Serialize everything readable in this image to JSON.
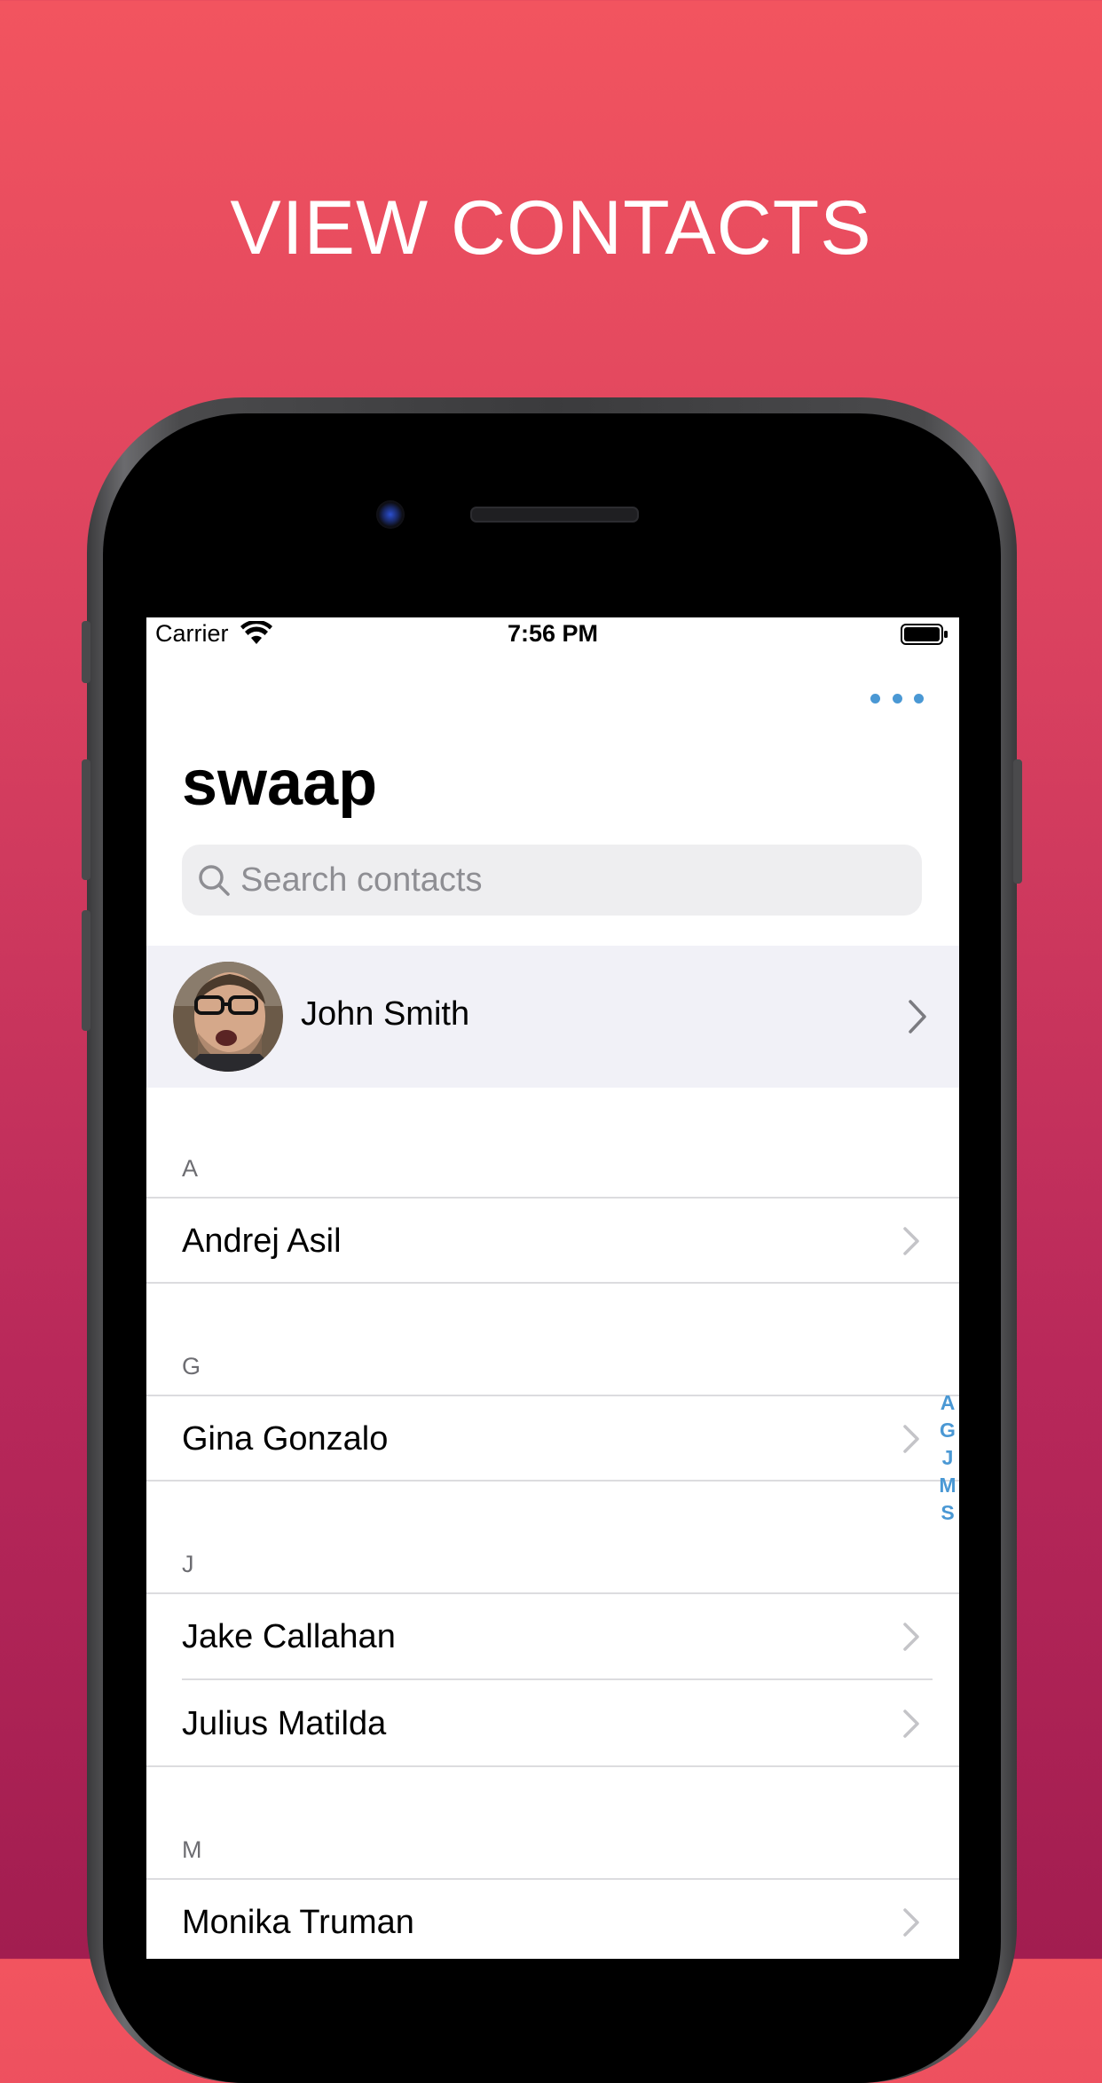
{
  "headline": "VIEW CONTACTS",
  "status_bar": {
    "carrier": "Carrier",
    "time": "7:56 PM"
  },
  "app": {
    "title": "swaap"
  },
  "search": {
    "placeholder": "Search contacts"
  },
  "me": {
    "name": "John Smith"
  },
  "sections": [
    {
      "letter": "A",
      "contacts": [
        "Andrej Asil"
      ]
    },
    {
      "letter": "G",
      "contacts": [
        "Gina Gonzalo"
      ]
    },
    {
      "letter": "J",
      "contacts": [
        "Jake Callahan",
        "Julius Matilda"
      ]
    },
    {
      "letter": "M",
      "contacts": [
        "Monika Truman"
      ]
    }
  ],
  "index_letters": [
    "A",
    "G",
    "J",
    "M",
    "S"
  ],
  "colors": {
    "accent": "#4a98d4",
    "gradient_top": "#f2545f",
    "gradient_bottom": "#a21d50"
  }
}
